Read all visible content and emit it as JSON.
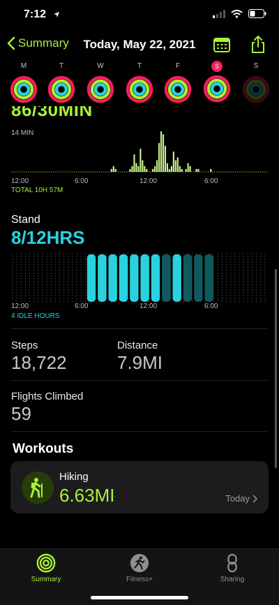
{
  "status": {
    "time": "7:12"
  },
  "nav": {
    "back_label": "Summary",
    "title": "Today, May 22, 2021"
  },
  "week": {
    "days": [
      "M",
      "T",
      "W",
      "T",
      "F",
      "S",
      "S"
    ],
    "today_index": 5
  },
  "move": {
    "value_text": "86/30MIN",
    "peak_label": "14 MIN",
    "axis_ticks": [
      "12:00",
      "6:00",
      "12:00",
      "6:00"
    ],
    "total_label": "TOTAL 10H 57M",
    "hourly_minutes": [
      0,
      0,
      0,
      0,
      0,
      0,
      0,
      0,
      0,
      0,
      0,
      0,
      0,
      0,
      0,
      0,
      0,
      0,
      0,
      0,
      0,
      0,
      0,
      0,
      0,
      0,
      0,
      0,
      0,
      0,
      0,
      0,
      0,
      0,
      0,
      0,
      0,
      0,
      0,
      0,
      0,
      0,
      0,
      0,
      0,
      0,
      0,
      0,
      1,
      2,
      1,
      0,
      0,
      0,
      0,
      0,
      0,
      1,
      2,
      6,
      3,
      2,
      8,
      4,
      2,
      1,
      0,
      0,
      1,
      2,
      4,
      10,
      14,
      13,
      9,
      3,
      1,
      2,
      7,
      4,
      5,
      2,
      1,
      0,
      1,
      3,
      2,
      0,
      0,
      1,
      1,
      0,
      0,
      0,
      0,
      0,
      1,
      0,
      0,
      0,
      0,
      0,
      0,
      0,
      0,
      0,
      0,
      0,
      0,
      0,
      0,
      0,
      0,
      0,
      0,
      0,
      0,
      0,
      0,
      0,
      0,
      0,
      0,
      0
    ],
    "colors": {
      "bar": "#c8f18a",
      "baseline": "#6bbf1a"
    }
  },
  "stand": {
    "title": "Stand",
    "value_text": "8/12HRS",
    "axis_ticks": [
      "12:00",
      "6:00",
      "12:00",
      "6:00"
    ],
    "idle_label": "4 IDLE HOURS",
    "hours": [
      0,
      0,
      0,
      0,
      0,
      0,
      0,
      1,
      1,
      1,
      1,
      1,
      1,
      1,
      0,
      1,
      0,
      0,
      0,
      0,
      0,
      0,
      0,
      0
    ],
    "colors": {
      "achieved": "#2ad2e0",
      "idle": "#0f5a5e"
    }
  },
  "stats": {
    "steps_label": "Steps",
    "steps_value": "18,722",
    "distance_label": "Distance",
    "distance_value": "7.9MI",
    "flights_label": "Flights Climbed",
    "flights_value": "59"
  },
  "workouts": {
    "title": "Workouts",
    "items": [
      {
        "name": "Hiking",
        "value": "6.63MI",
        "date": "Today"
      }
    ]
  },
  "tabbar": {
    "tabs": [
      {
        "label": "Summary",
        "icon": "activity-rings-icon"
      },
      {
        "label": "Fitness+",
        "icon": "runner-icon"
      },
      {
        "label": "Sharing",
        "icon": "sharing-icon"
      }
    ],
    "active_index": 0,
    "colors": {
      "active": "#a8f03a",
      "inactive": "#8e8e93"
    }
  }
}
